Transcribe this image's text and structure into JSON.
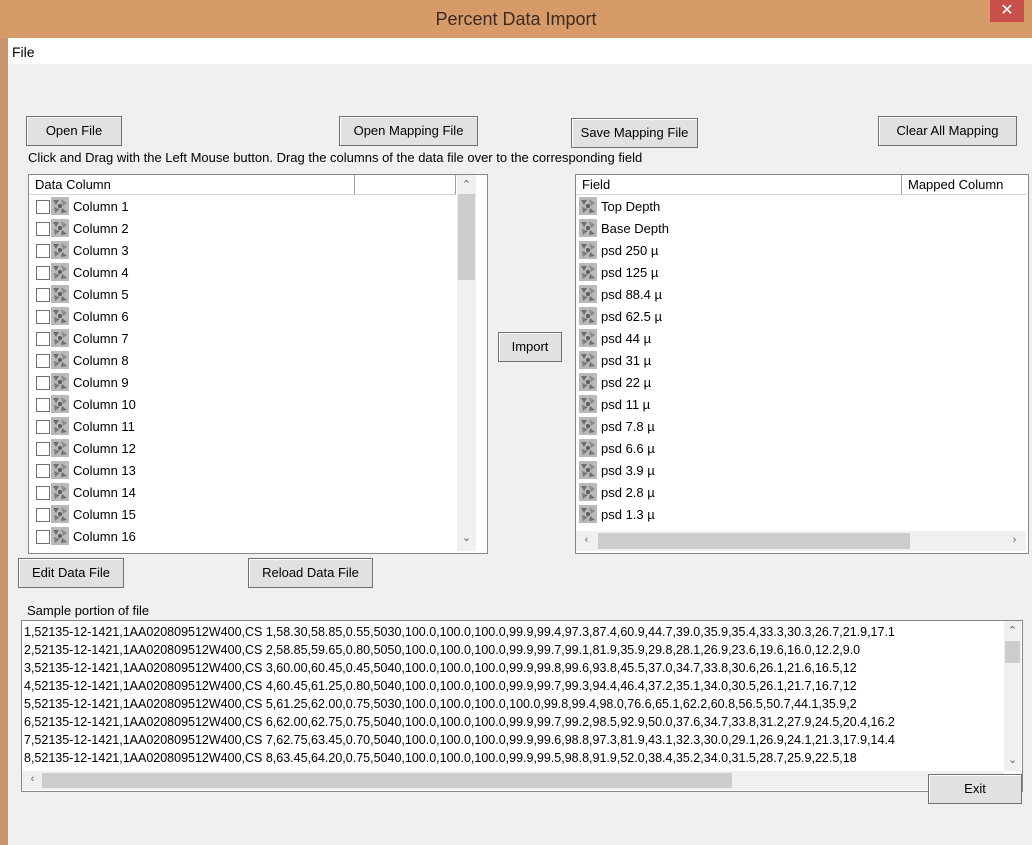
{
  "window": {
    "title": "Percent Data Import",
    "close_label": "✕"
  },
  "menu": {
    "file": "File"
  },
  "buttons": {
    "open_file": "Open File",
    "open_mapping_file": "Open Mapping File",
    "save_mapping_file": "Save Mapping File",
    "clear_all_mapping": "Clear All Mapping",
    "import": "Import",
    "edit_data_file": "Edit Data File",
    "reload_data_file": "Reload Data File",
    "exit": "Exit"
  },
  "instruction": "Click and Drag with the Left Mouse button. Drag the columns of the data file over to the corresponding field",
  "data_columns": {
    "header": "Data Column",
    "items": [
      "Column 1",
      "Column 2",
      "Column 3",
      "Column 4",
      "Column 5",
      "Column 6",
      "Column 7",
      "Column 8",
      "Column 9",
      "Column 10",
      "Column 11",
      "Column 12",
      "Column 13",
      "Column 14",
      "Column 15",
      "Column 16"
    ]
  },
  "fields": {
    "header_field": "Field",
    "header_mapped": "Mapped Column",
    "items": [
      "Top Depth",
      "Base Depth",
      "psd 250 µ",
      "psd 125 µ",
      "psd 88.4 µ",
      "psd 62.5 µ",
      "psd 44 µ",
      "psd 31 µ",
      "psd 22 µ",
      "psd 11 µ",
      "psd 7.8 µ",
      "psd 6.6 µ",
      "psd 3.9  µ",
      "psd 2.8 µ",
      "psd 1.3 µ"
    ]
  },
  "sample": {
    "label": "Sample portion of file",
    "lines": [
      "1,52135-12-1421,1AA020809512W400,CS 1,58.30,58.85,0.55,5030,100.0,100.0,100.0,99.9,99.4,97.3,87.4,60.9,44.7,39.0,35.9,35.4,33.3,30.3,26.7,21.9,17.1",
      "2,52135-12-1421,1AA020809512W400,CS 2,58.85,59.65,0.80,5050,100.0,100.0,100.0,99.9,99.7,99.1,81.9,35.9,29.8,28.1,26.9,23.6,19.6,16.0,12.2,9.0",
      "3,52135-12-1421,1AA020809512W400,CS 3,60.00,60.45,0.45,5040,100.0,100.0,100.0,99.9,99.8,99.6,93.8,45.5,37.0,34.7,33.8,30.6,26.1,21.6,16.5,12",
      "4,52135-12-1421,1AA020809512W400,CS 4,60.45,61.25,0.80,5040,100.0,100.0,100.0,99.9,99.7,99.3,94.4,46.4,37.2,35.1,34.0,30.5,26.1,21.7,16.7,12",
      "5,52135-12-1421,1AA020809512W400,CS 5,61.25,62.00,0.75,5030,100.0,100.0,100.0,100.0,99.8,99.4,98.0,76.6,65.1,62.2,60.8,56.5,50.7,44.1,35.9,2",
      "6,52135-12-1421,1AA020809512W400,CS 6,62.00,62.75,0.75,5040,100.0,100.0,100.0,99.9,99.7,99.2,98.5,92.9,50.0,37.6,34.7,33.8,31.2,27.9,24.5,20.4,16.2",
      "7,52135-12-1421,1AA020809512W400,CS 7,62.75,63.45,0.70,5040,100.0,100.0,100.0,99.9,99.6,98.8,97.3,81.9,43.1,32.3,30.0,29.1,26.9,24.1,21.3,17.9,14.4",
      "8,52135-12-1421,1AA020809512W400,CS 8,63.45,64.20,0.75,5040,100.0,100.0,100.0,99.9,99.5,98.8,91.9,52.0,38.4,35.2,34.0,31.5,28.7,25.9,22.5,18"
    ]
  }
}
